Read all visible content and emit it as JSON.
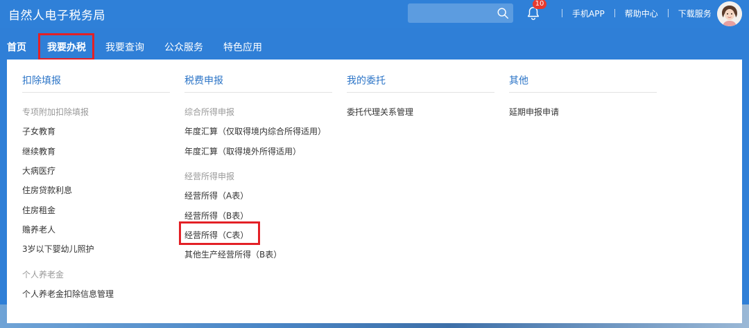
{
  "header": {
    "title": "自然人电子税务局",
    "search_placeholder": "",
    "notification_count": "10",
    "links": [
      "手机APP",
      "帮助中心",
      "下载服务"
    ]
  },
  "nav": {
    "items": [
      "首页",
      "我要办税",
      "我要查询",
      "公众服务",
      "特色应用"
    ],
    "active": "我要办税"
  },
  "menu": {
    "col1": {
      "heading": "扣除填报",
      "group1_label": "专项附加扣除填报",
      "group1_items": [
        "子女教育",
        "继续教育",
        "大病医疗",
        "住房贷款利息",
        "住房租金",
        "赡养老人",
        "3岁以下婴幼儿照护"
      ],
      "group2_label": "个人养老金",
      "group2_items": [
        "个人养老金扣除信息管理"
      ]
    },
    "col2": {
      "heading": "税费申报",
      "group1_label": "综合所得申报",
      "group1_items": [
        "年度汇算（仅取得境内综合所得适用）",
        "年度汇算（取得境外所得适用）"
      ],
      "group2_label": "经营所得申报",
      "group2_items": [
        "经营所得（A表）",
        "经营所得（B表）",
        "经营所得（C表）",
        "其他生产经营所得（B表）"
      ]
    },
    "col3": {
      "heading": "我的委托",
      "items": [
        "委托代理关系管理"
      ]
    },
    "col4": {
      "heading": "其他",
      "items": [
        "延期申报申请"
      ]
    }
  },
  "colors": {
    "header_bg": "#2f80d8",
    "accent_link": "#2b74c7",
    "highlight_red": "#e32026"
  }
}
